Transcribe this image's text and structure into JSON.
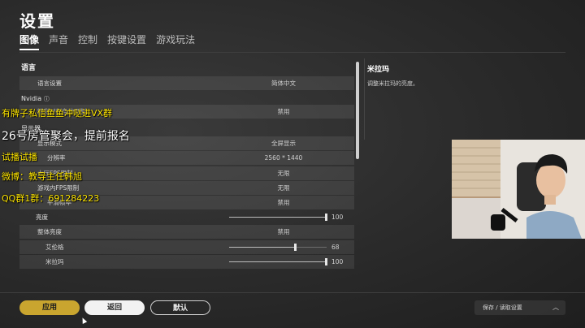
{
  "title": "设置",
  "tabs": [
    "图像",
    "声音",
    "控制",
    "按键设置",
    "游戏玩法"
  ],
  "active_tab": 0,
  "panel": {
    "section_language": "语言",
    "language_label": "语言设置",
    "language_value": "简体中文",
    "nvidia_label": "Nvidia",
    "nvidia_icon": "info-icon",
    "highlight_label": "精彩时刻自动录制",
    "highlight_value": "禁用",
    "rows_display": [
      {
        "label": "显示器",
        "value": ""
      },
      {
        "label": "显示模式",
        "value": "全屏显示"
      },
      {
        "label": "分辨率",
        "value": "2560 * 1440"
      },
      {
        "label": "大厅FPS限制",
        "value": "无限"
      },
      {
        "label": "游戏内FPS限制",
        "value": "无限"
      },
      {
        "label": "平滑帧率",
        "value": "禁用"
      }
    ],
    "brightness_label": "亮度",
    "brightness_value": 100,
    "overall_label": "整体亮度",
    "overall_value": "禁用",
    "erangel_label": "艾伦格",
    "erangel_value": 68,
    "miramar_label": "米拉玛",
    "miramar_value": 100
  },
  "info": {
    "title": "米拉玛",
    "description": "调整米拉玛的亮度。"
  },
  "overlay": {
    "line1": "有牌子私信鱼鱼冲哒进VX群",
    "line2": "26号房管聚会，提前报名",
    "line3": "试播试播",
    "line4": "微博：教导主任韩旭",
    "line5": "QQ群1群：691284223"
  },
  "buttons": {
    "apply": "应用",
    "back": "返回",
    "default": "默认",
    "save_load": "保存 / 读取设置"
  },
  "colors": {
    "apply": "#c9a52f",
    "overlay_yellow": "#ffe600"
  }
}
